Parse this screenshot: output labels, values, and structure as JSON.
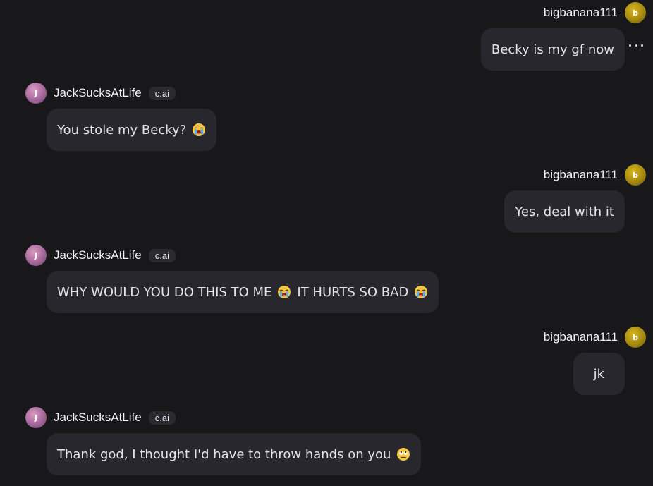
{
  "user": {
    "name": "bigbanana111",
    "initial": "b"
  },
  "bot": {
    "name": "JackSucksAtLife",
    "initial": "J",
    "badge": "c.ai"
  },
  "messages": [
    {
      "text": "Becky is my gf now"
    },
    {
      "text": "You stole my Becky?",
      "emoji": "loudly-crying-face"
    },
    {
      "text": "Yes, deal with it"
    },
    {
      "text_before": "WHY WOULD YOU DO THIS TO ME",
      "emoji": "loudly-crying-face",
      "text_after": "IT HURTS SO BAD",
      "emoji_after": "loudly-crying-face"
    },
    {
      "text": "jk"
    },
    {
      "text": "Thank god, I thought I'd have to throw hands on you",
      "emoji": "face-with-rolling-eyes"
    }
  ]
}
